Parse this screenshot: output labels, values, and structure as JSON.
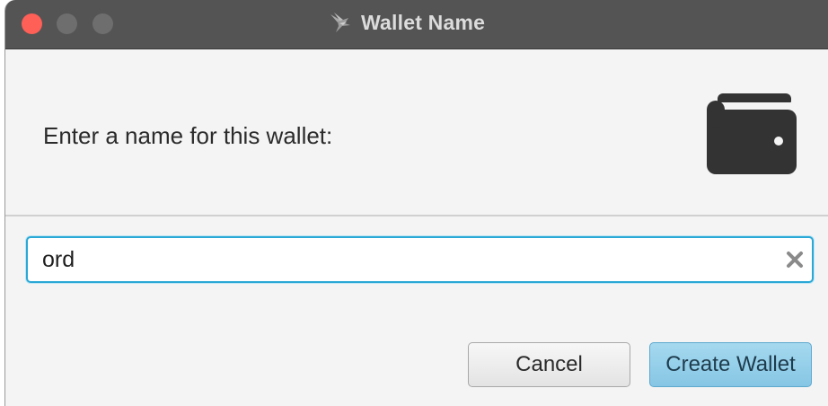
{
  "window": {
    "title": "Wallet Name",
    "app_icon": "sparrow-bird-icon"
  },
  "dialog": {
    "prompt": "Enter a name for this wallet:",
    "icon": "wallet-icon"
  },
  "name_field": {
    "value": "ord",
    "clear_icon": "clear-x-icon"
  },
  "buttons": {
    "cancel_label": "Cancel",
    "create_label": "Create Wallet"
  },
  "colors": {
    "accent": "#2aa8d6",
    "default_button": "#94cfe9",
    "close_button": "#fe5f57"
  }
}
